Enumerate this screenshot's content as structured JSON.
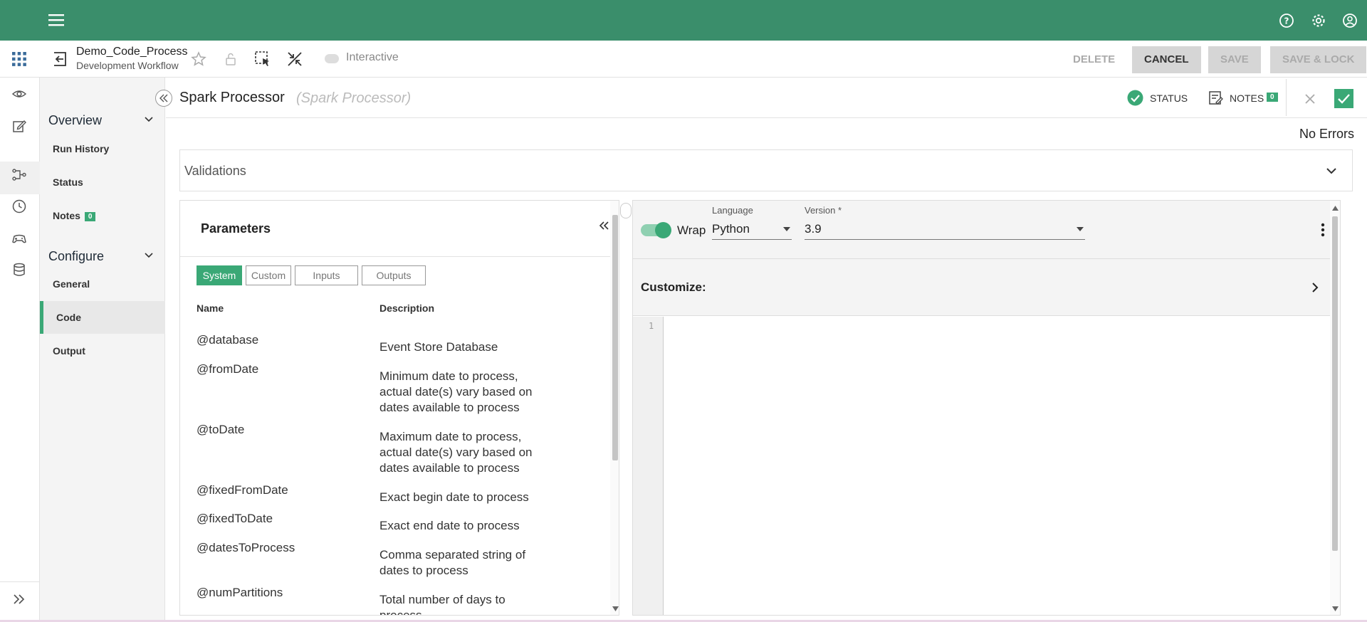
{
  "header": {
    "process_name": "Demo_Code_Process",
    "workflow_name": "Development Workflow",
    "interactive_label": "Interactive",
    "buttons": {
      "delete": "DELETE",
      "cancel": "CANCEL",
      "save": "SAVE",
      "save_lock": "SAVE & LOCK"
    }
  },
  "sidenav": {
    "overview": "Overview",
    "overview_items": [
      {
        "label": "Run History"
      },
      {
        "label": "Status"
      },
      {
        "label": "Notes",
        "badge": "0"
      }
    ],
    "configure": "Configure",
    "configure_items": [
      {
        "label": "General"
      },
      {
        "label": "Code"
      },
      {
        "label": "Output"
      }
    ]
  },
  "processor": {
    "title": "Spark Processor",
    "subtitle": "(Spark Processor)",
    "status_label": "STATUS",
    "notes_label": "NOTES",
    "notes_count": "0",
    "errors_text": "No Errors",
    "validations_label": "Validations"
  },
  "parameters": {
    "title": "Parameters",
    "tabs": [
      "System",
      "Custom",
      "Inputs",
      "Outputs"
    ],
    "col_name": "Name",
    "col_desc": "Description",
    "rows": [
      {
        "name": "@database",
        "desc": "Event Store Database"
      },
      {
        "name": "@fromDate",
        "desc": "Minimum date to process, actual date(s) vary based on dates available to process"
      },
      {
        "name": "@toDate",
        "desc": "Maximum date to process, actual date(s) vary based on dates available to process"
      },
      {
        "name": "@fixedFromDate",
        "desc": "Exact begin date to process"
      },
      {
        "name": "@fixedToDate",
        "desc": "Exact end date to process"
      },
      {
        "name": "@datesToProcess",
        "desc": "Comma separated string of dates to process"
      },
      {
        "name": "@numPartitions",
        "desc": "Total number of days to process"
      }
    ]
  },
  "editor": {
    "wrap_label": "Wrap",
    "language_label": "Language",
    "language_value": "Python",
    "version_label": "Version *",
    "version_value": "3.9",
    "customize_label": "Customize:",
    "line_number": "1"
  },
  "colors": {
    "brand": "#3a8e6b",
    "accent": "#3aa876"
  }
}
